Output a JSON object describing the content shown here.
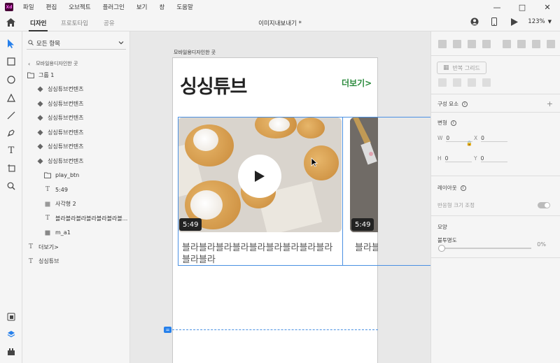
{
  "app": {
    "logo_text": "Xd"
  },
  "menu": [
    "파일",
    "편집",
    "오브젝트",
    "플러그인",
    "보기",
    "창",
    "도움말"
  ],
  "tabs": [
    "디자인",
    "프로토타입",
    "공유"
  ],
  "document_title": "이미지내보내기 *",
  "zoom": "123%",
  "layers_panel": {
    "filter_label": "모든 항목",
    "breadcrumb": "모바일용디자인한 곳",
    "items": [
      {
        "label": "그룹 1",
        "icon": "folder-icon"
      },
      {
        "label": "싱싱튜브컨텐츠",
        "icon": "component-icon"
      },
      {
        "label": "싱싱튜브컨텐츠",
        "icon": "component-icon"
      },
      {
        "label": "싱싱튜브컨텐츠",
        "icon": "component-icon"
      },
      {
        "label": "싱싱튜브컨텐츠",
        "icon": "component-icon"
      },
      {
        "label": "싱싱튜브컨텐츠",
        "icon": "component-icon"
      },
      {
        "label": "싱싱튜브컨텐츠",
        "icon": "component-icon"
      },
      {
        "label": "play_btn",
        "icon": "folder-icon"
      },
      {
        "label": "5:49",
        "icon": "text-icon"
      },
      {
        "label": "사각형 2",
        "icon": "rectangle-icon"
      },
      {
        "label": "블라블라블라블라블라블라블...",
        "icon": "text-icon"
      },
      {
        "label": "m_a1",
        "icon": "image-icon"
      },
      {
        "label": "더보기>",
        "icon": "text-icon"
      },
      {
        "label": "싱싱튜브",
        "icon": "text-icon"
      }
    ]
  },
  "canvas": {
    "artboard_label": "모바일용디자인한 곳",
    "title": "싱싱튜브",
    "more_link": "더보기>",
    "card1": {
      "duration": "5:49",
      "text": "블라블라블라블라블라블라블라블라블라블라블라"
    },
    "card2": {
      "duration": "5:49",
      "text": "블라블라"
    }
  },
  "inspector": {
    "repeat_grid": "반복 그리드",
    "components_label": "구성 요소",
    "transform_label": "변형",
    "fields": {
      "w": "0",
      "x": "0",
      "h": "0",
      "y": "0"
    },
    "layout_label": "레이아웃",
    "responsive_label": "반응형 크기 조정",
    "appearance_label": "모양",
    "opacity_label": "불투명도",
    "opacity_value": "0%"
  },
  "colors": {
    "accent": "#2680eb",
    "green_link": "#2a8a3c",
    "xd_brand": "#470137"
  }
}
